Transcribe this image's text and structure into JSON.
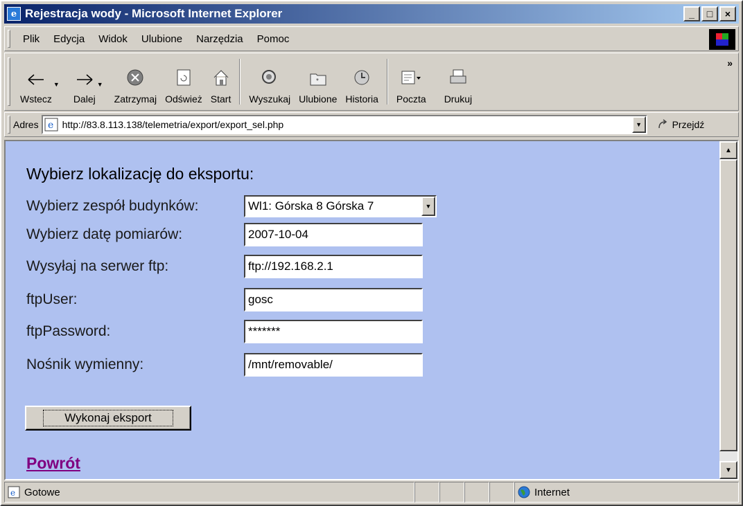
{
  "window": {
    "title": "Rejestracja wody - Microsoft Internet Explorer",
    "buttons": {
      "minimize": "_",
      "maximize": "□",
      "close": "×"
    }
  },
  "menu": [
    "Plik",
    "Edycja",
    "Widok",
    "Ulubione",
    "Narzędzia",
    "Pomoc"
  ],
  "toolbar": {
    "back": "Wstecz",
    "forward": "Dalej",
    "stop": "Zatrzymaj",
    "refresh": "Odśwież",
    "home": "Start",
    "search": "Wyszukaj",
    "favorites": "Ulubione",
    "history": "Historia",
    "mail": "Poczta",
    "print": "Drukuj",
    "more": "»"
  },
  "address": {
    "label": "Adres",
    "url": "http://83.8.113.138/telemetria/export/export_sel.php",
    "go": "Przejdź"
  },
  "page": {
    "heading": "Wybierz lokalizację do eksportu:",
    "fields": {
      "building": {
        "label": "Wybierz zespół budynków:",
        "value": "Wl1: Górska 8 Górska 7"
      },
      "date": {
        "label": "Wybierz datę pomiarów:",
        "value": "2007-10-04"
      },
      "ftp": {
        "label": "Wysyłaj na serwer ftp:",
        "value": "ftp://192.168.2.1"
      },
      "ftp_user": {
        "label": "ftpUser:",
        "value": "gosc"
      },
      "ftp_password": {
        "label": "ftpPassword:",
        "value": "*******"
      },
      "removable": {
        "label": "Nośnik wymienny:",
        "value": "/mnt/removable/"
      }
    },
    "submit": "Wykonaj eksport",
    "back_link": "Powrót"
  },
  "status": {
    "text": "Gotowe",
    "zone": "Internet"
  },
  "colors": {
    "page_background": "#afc1f0",
    "titlebar_start": "#0a246a",
    "titlebar_end": "#a6caf0",
    "visited_link": "#800080"
  }
}
